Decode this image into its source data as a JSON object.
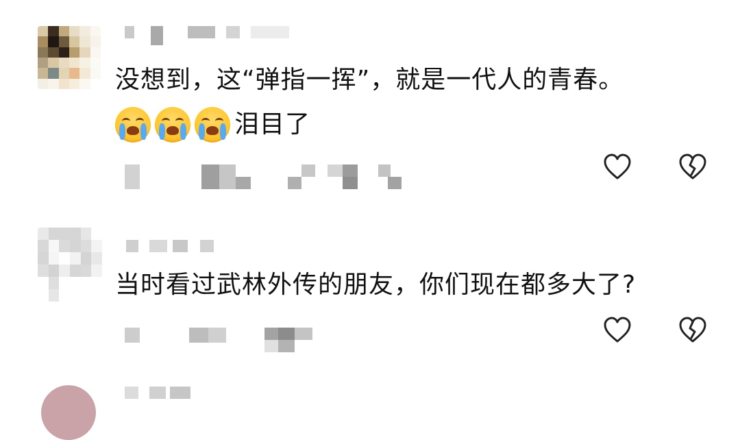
{
  "comments": [
    {
      "text_line1": "没想到，这“弹指一挥”，就是一代人的青春。",
      "text_line2": "泪目了",
      "emoji_count": 3,
      "emoji_name": "crying-face-icon"
    },
    {
      "text_line1": "当时看过武林外传的朋友，你们现在都多大了?"
    }
  ],
  "icons": {
    "like": "heart-outline-icon",
    "dislike": "broken-heart-icon"
  },
  "colors": {
    "text": "#111111",
    "icon": "#222222",
    "background": "#ffffff"
  }
}
